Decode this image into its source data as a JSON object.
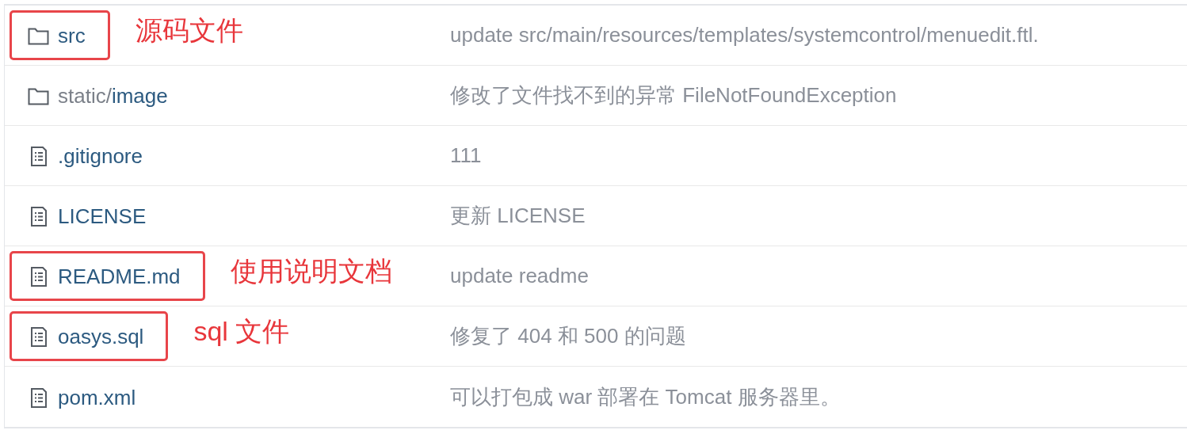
{
  "files": [
    {
      "kind": "folder",
      "name": "src",
      "message": "update src/main/resources/templates/systemcontrol/menuedit.ftl.",
      "highlighted": true,
      "annotation": "源码文件"
    },
    {
      "kind": "folder",
      "prefix": "static/",
      "name": "image",
      "message": "修改了文件找不到的异常 FileNotFoundException",
      "highlighted": false
    },
    {
      "kind": "file",
      "name": ".gitignore",
      "message": "111",
      "highlighted": false
    },
    {
      "kind": "file",
      "name": "LICENSE",
      "message": "更新 LICENSE",
      "highlighted": false
    },
    {
      "kind": "file",
      "name": "README.md",
      "message": "update readme",
      "highlighted": true,
      "annotation": "使用说明文档"
    },
    {
      "kind": "file",
      "name": "oasys.sql",
      "message": "修复了 404 和 500 的问题",
      "highlighted": true,
      "annotation": "sql 文件"
    },
    {
      "kind": "file",
      "name": "pom.xml",
      "message": "可以打包成 war 部署在 Tomcat 服务器里。",
      "highlighted": false
    }
  ]
}
